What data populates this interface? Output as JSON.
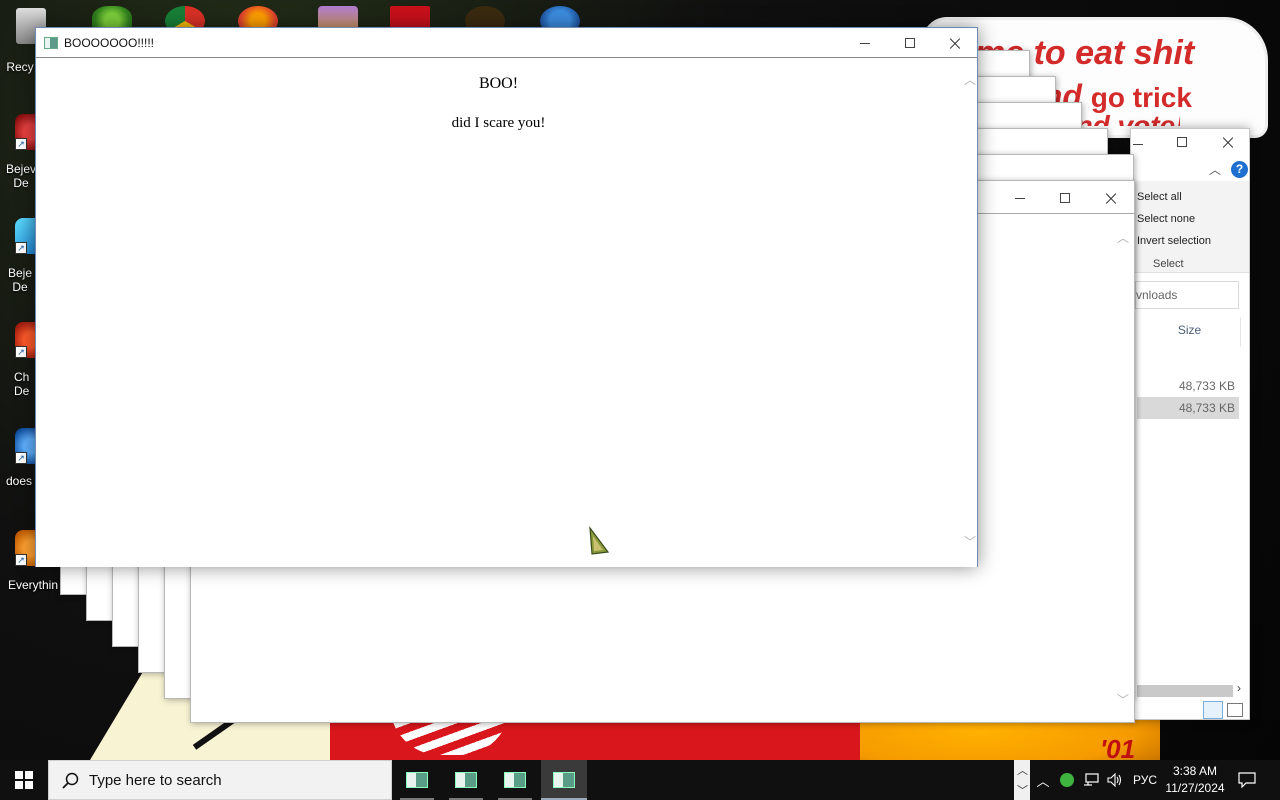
{
  "desktop": {
    "icons": [
      {
        "label": "Recy"
      },
      {
        "label": "Bejev\nDe"
      },
      {
        "label": "Beje\nDe"
      },
      {
        "label": "Ch\nDe"
      },
      {
        "label": "does"
      },
      {
        "label": "Everythin"
      }
    ],
    "wallpaper_sign": {
      "line1": "me to eat shit",
      "line2a": "and",
      "line2b": "go trick",
      "line3": "and vote!"
    },
    "wallpaper_year": "'01"
  },
  "explorer": {
    "ribbon": [
      "Select all",
      "Select none",
      "Invert selection"
    ],
    "ribbon_group": "Select",
    "address": "vnloads",
    "column_size": "Size",
    "files": [
      {
        "size": "48,733 KB",
        "selected": false
      },
      {
        "size": "48,733 KB",
        "selected": true
      }
    ],
    "help_label": "?"
  },
  "main_window": {
    "title": "BOOOOOOO!!!!!",
    "heading": "BOO!",
    "message": "did I scare you!"
  },
  "taskbar": {
    "search_placeholder": "Type here to search",
    "language": "РУС",
    "time": "3:38 AM",
    "date": "11/27/2024"
  },
  "colors": {
    "taskbar": "#101010",
    "wallpaper_red": "#d8161b",
    "sign_text": "#d32a2a",
    "help_blue": "#1f6fd1"
  }
}
